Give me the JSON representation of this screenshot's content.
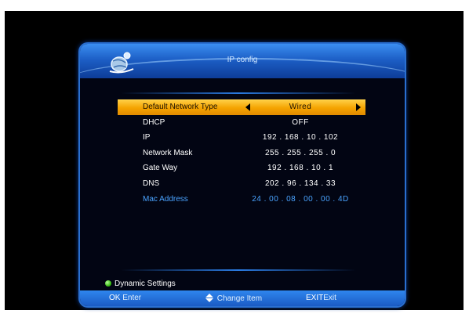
{
  "window": {
    "title": "IP config"
  },
  "settings": [
    {
      "label": "Default Network Type",
      "value": "Wired"
    },
    {
      "label": "DHCP",
      "value": "OFF"
    },
    {
      "label": "IP",
      "value": "192 . 168 . 10 . 102"
    },
    {
      "label": "Network Mask",
      "value": "255 . 255 . 255 . 0"
    },
    {
      "label": "Gate Way",
      "value": "192 . 168 . 10 . 1"
    },
    {
      "label": "DNS",
      "value": "202 . 96 . 134 . 33"
    },
    {
      "label": "Mac Address",
      "value": "24 . 00 . 08 . 00 . 00 . 4D"
    }
  ],
  "green_hint": "Dynamic Settings",
  "footer": {
    "ok_key": "OK",
    "ok_label": "Enter",
    "change_label": "Change Item",
    "exit_key": "EXIT",
    "exit_label": "Exit"
  },
  "colors": {
    "accent": "#2a7ae0",
    "highlight": "#f5a300",
    "mac_text": "#4aa3ff",
    "green_dot": "#26b100"
  },
  "icons": {
    "logo": "satellite-globe-icon",
    "left_arrow": "triangle-left-icon",
    "right_arrow": "triangle-right-icon",
    "updown": "up-down-arrows-icon"
  }
}
